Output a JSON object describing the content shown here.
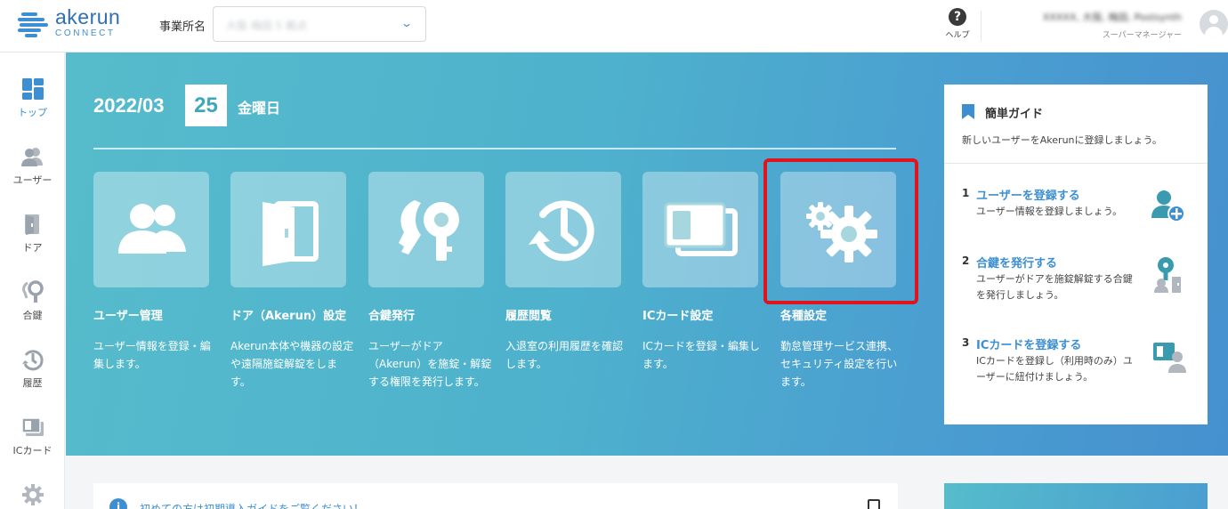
{
  "header": {
    "logo_word": "akerun",
    "logo_sub": "CONNECT",
    "office_label": "事業所名",
    "office_value": "大阪 梅田 5 拠点",
    "help_label": "ヘルプ",
    "user_name": "XXXXX, 大阪, 梅田, Postsynth",
    "user_role": "スーパーマネージャー"
  },
  "sidebar": {
    "items": [
      {
        "label": "トップ",
        "icon": "dashboard-icon",
        "active": true
      },
      {
        "label": "ユーザー",
        "icon": "users-icon"
      },
      {
        "label": "ドア",
        "icon": "door-icon"
      },
      {
        "label": "合鍵",
        "icon": "key-icon"
      },
      {
        "label": "履歴",
        "icon": "history-icon"
      },
      {
        "label": "ICカード",
        "icon": "ic-card-icon"
      },
      {
        "label": "",
        "icon": "gear-icon"
      }
    ]
  },
  "hero": {
    "year_month": "2022/03",
    "day": "25",
    "weekday": "金曜日",
    "cards": [
      {
        "title": "ユーザー管理",
        "desc": "ユーザー情報を登録・編集します。",
        "icon": "users-icon"
      },
      {
        "title": "ドア（Akerun）設定",
        "desc": "Akerun本体や機器の設定や遠隔施錠解錠をします。",
        "icon": "door-icon"
      },
      {
        "title": "合鍵発行",
        "desc": "ユーザーがドア（Akerun）を施錠・解錠する権限を発行します。",
        "icon": "key-icon"
      },
      {
        "title": "履歴閲覧",
        "desc": "入退室の利用履歴を確認します。",
        "icon": "history-icon"
      },
      {
        "title": "ICカード設定",
        "desc": "ICカードを登録・編集します。",
        "icon": "ic-card-icon"
      },
      {
        "title": "各種設定",
        "desc": "勤怠管理サービス連携、セキュリティ設定を行います。",
        "icon": "gear-icon"
      }
    ]
  },
  "guide": {
    "title": "簡単ガイド",
    "subtitle": "新しいユーザーをAkerunに登録しましょう。",
    "steps": [
      {
        "num": "1",
        "title": "ユーザーを登録する",
        "desc": "ユーザー情報を登録しましょう。",
        "icon": "add-user-icon"
      },
      {
        "num": "2",
        "title": "合鍵を発行する",
        "desc": "ユーザーがドアを施錠解錠する合鍵を発行しましょう。",
        "icon": "issue-key-icon"
      },
      {
        "num": "3",
        "title": "ICカードを登録する",
        "desc": "ICカードを登録し（利用時のみ）ユーザーに紐付けましょう。",
        "icon": "link-card-icon"
      }
    ]
  },
  "notice": {
    "text": "初めての方は初期導入ガイドをご覧ください！",
    "icon": "info-icon"
  },
  "colors": {
    "brand": "#3d8fd1",
    "hero_start": "#56bccb",
    "hero_end": "#4690cf",
    "highlight": "#e2141b"
  }
}
